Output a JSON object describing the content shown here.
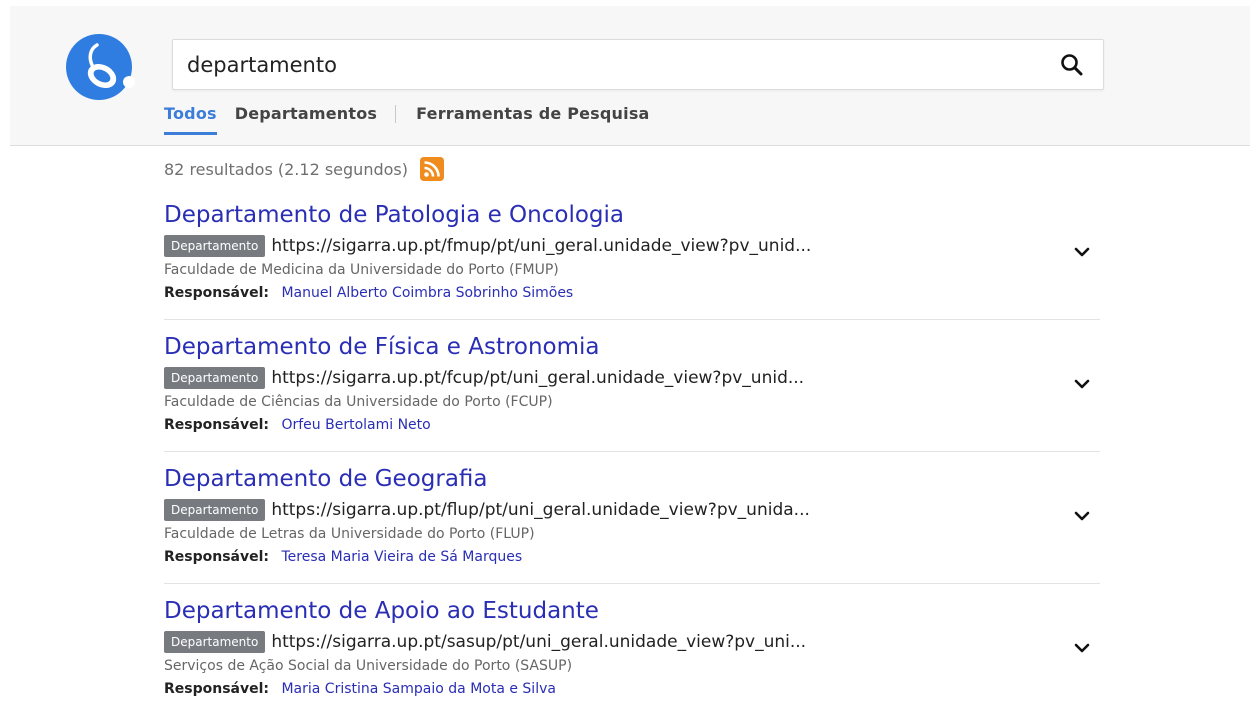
{
  "search": {
    "query": "departamento"
  },
  "tabs": [
    {
      "label": "Todos"
    },
    {
      "label": "Departamentos"
    },
    {
      "label": "Ferramentas de Pesquisa"
    }
  ],
  "stats": {
    "text": "82 resultados (2.12 segundos)"
  },
  "results": [
    {
      "title": "Departamento de Patologia e Oncologia",
      "badge": "Departamento",
      "url": "https://sigarra.up.pt/fmup/pt/uni_geral.unidade_view?pv_unid...",
      "faculty": "Faculdade de Medicina da Universidade do Porto (FMUP)",
      "resp_label": "Responsável:",
      "resp_name": "Manuel Alberto Coimbra Sobrinho Simões"
    },
    {
      "title": "Departamento de Física e Astronomia",
      "badge": "Departamento",
      "url": "https://sigarra.up.pt/fcup/pt/uni_geral.unidade_view?pv_unid...",
      "faculty": "Faculdade de Ciências da Universidade do Porto (FCUP)",
      "resp_label": "Responsável:",
      "resp_name": "Orfeu Bertolami Neto"
    },
    {
      "title": "Departamento de Geografia",
      "badge": "Departamento",
      "url": "https://sigarra.up.pt/flup/pt/uni_geral.unidade_view?pv_unida...",
      "faculty": "Faculdade de Letras da Universidade do Porto (FLUP)",
      "resp_label": "Responsável:",
      "resp_name": "Teresa Maria Vieira de Sá Marques"
    },
    {
      "title": "Departamento de Apoio ao Estudante",
      "badge": "Departamento",
      "url": "https://sigarra.up.pt/sasup/pt/uni_geral.unidade_view?pv_uni...",
      "faculty": "Serviços de Ação Social da Universidade do Porto (SASUP)",
      "resp_label": "Responsável:",
      "resp_name": "Maria Cristina Sampaio da Mota e Silva"
    }
  ],
  "icons": {
    "logo": "computer-mouse-logo-icon",
    "search": "search-icon",
    "rss": "rss-feed-icon",
    "expand": "chevron-down-icon"
  },
  "colors": {
    "accent": "#3b7dd8",
    "link": "#2a2eb4",
    "logo": "#2f7de1",
    "rss": "#f08b1d",
    "badge": "#777b80"
  }
}
